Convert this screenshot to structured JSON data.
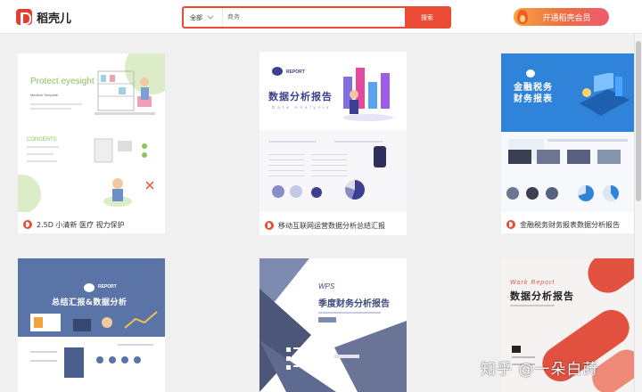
{
  "header": {
    "logo_text": "稻壳儿",
    "search": {
      "scope": "全部",
      "placeholder": "商务",
      "button": "搜索"
    },
    "vip_button": "开通稻壳会员"
  },
  "cards": [
    {
      "caption": "2.5D 小清新 医疗 视力保护",
      "thumb": {
        "title": "Protect eyesight",
        "subtitle": "Medical Template",
        "section": "CONCENTS"
      }
    },
    {
      "caption": "移动互联网运营数据分析总结汇报",
      "thumb": {
        "title": "数据分析报告",
        "subtitle": "Data Analysis",
        "badge": "REPORT"
      }
    },
    {
      "caption": "金融税务财务报表数据分析报告",
      "thumb": {
        "title_line1": "金融税务",
        "title_line2": "财务报表"
      }
    },
    {
      "caption": "",
      "thumb": {
        "title": "总结汇报&数据分析",
        "badge": "REPORT"
      }
    },
    {
      "caption": "",
      "thumb": {
        "title": "季度财务分析报告",
        "brand": "WPS"
      }
    },
    {
      "caption": "",
      "thumb": {
        "title": "数据分析报告",
        "kicker": "Work Report"
      }
    }
  ],
  "watermark": "知乎 @一朵白莳",
  "colors": {
    "brand_red": "#e94b35",
    "vip_orange": "#f6a23e",
    "mint": "#8cc45a",
    "report_navy": "#3c3f8f",
    "finance_blue": "#2f84d9",
    "slate": "#5b74a7"
  }
}
